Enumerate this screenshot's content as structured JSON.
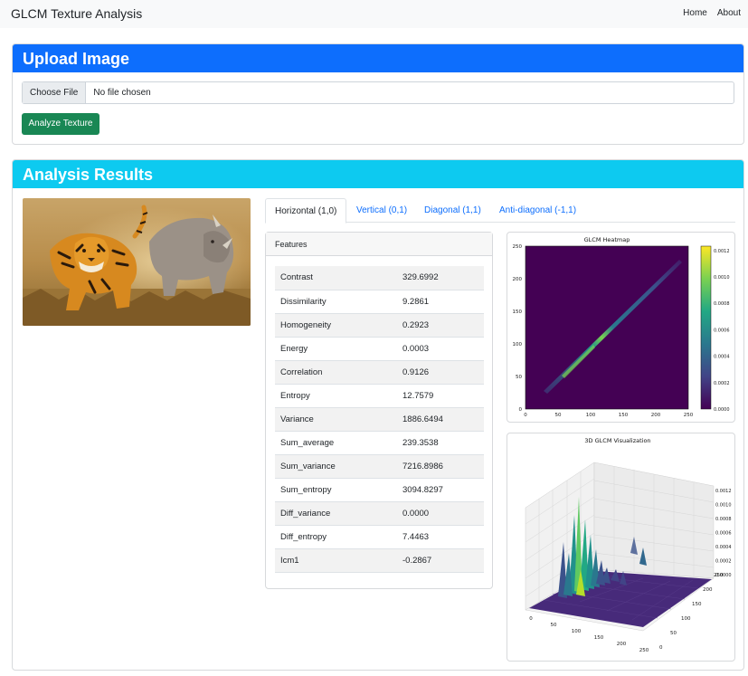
{
  "nav": {
    "brand": "GLCM Texture Analysis",
    "links": [
      "Home",
      "About"
    ]
  },
  "upload": {
    "title": "Upload Image",
    "choose_label": "Choose File",
    "file_status": "No file chosen",
    "analyze_label": "Analyze Texture"
  },
  "results": {
    "title": "Analysis Results",
    "tabs": [
      "Horizontal (1,0)",
      "Vertical (0,1)",
      "Diagonal (1,1)",
      "Anti-diagonal (-1,1)"
    ],
    "active_tab": 0,
    "features_title": "Features",
    "features": [
      {
        "name": "Contrast",
        "value": "329.6992"
      },
      {
        "name": "Dissimilarity",
        "value": "9.2861"
      },
      {
        "name": "Homogeneity",
        "value": "0.2923"
      },
      {
        "name": "Energy",
        "value": "0.0003"
      },
      {
        "name": "Correlation",
        "value": "0.9126"
      },
      {
        "name": "Entropy",
        "value": "12.7579"
      },
      {
        "name": "Variance",
        "value": "1886.6494"
      },
      {
        "name": "Sum_average",
        "value": "239.3538"
      },
      {
        "name": "Sum_variance",
        "value": "7216.8986"
      },
      {
        "name": "Sum_entropy",
        "value": "3094.8297"
      },
      {
        "name": "Diff_variance",
        "value": "0.0000"
      },
      {
        "name": "Diff_entropy",
        "value": "7.4463"
      },
      {
        "name": "Icm1",
        "value": "-0.2867"
      }
    ]
  },
  "heatmap": {
    "title": "GLCM Heatmap",
    "xticks": [
      "0",
      "50",
      "100",
      "150",
      "200",
      "250"
    ],
    "yticks": [
      "0",
      "50",
      "100",
      "150",
      "200",
      "250"
    ],
    "colorbar_ticks": [
      "0.0000",
      "0.0002",
      "0.0004",
      "0.0006",
      "0.0008",
      "0.0010",
      "0.0012"
    ]
  },
  "surface": {
    "title": "3D GLCM Visualization",
    "z_ticks": [
      "0.0000",
      "0.0002",
      "0.0004",
      "0.0006",
      "0.0008",
      "0.0010",
      "0.0012"
    ],
    "x_ticks": [
      "0",
      "50",
      "100",
      "150",
      "200",
      "250"
    ],
    "y_ticks": [
      "0",
      "50",
      "100",
      "150",
      "200",
      "250"
    ]
  },
  "colors": {
    "primary": "#0d6efd",
    "info": "#0dcaf0",
    "success": "#198754",
    "viridis_bg": "#440154"
  }
}
